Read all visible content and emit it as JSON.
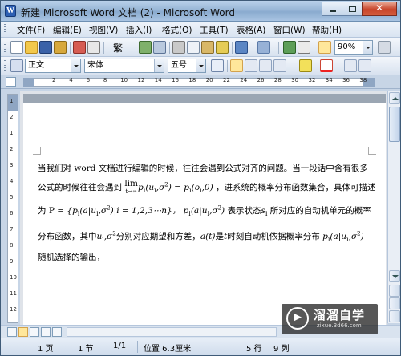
{
  "window": {
    "title": "新建 Microsoft Word 文档 (2) - Microsoft Word",
    "icon_name": "word-app-icon",
    "minimize_icon": "minimize-icon",
    "maximize_icon": "maximize-icon",
    "close_icon": "close-icon",
    "close_glyph": "✕"
  },
  "menubar": {
    "items": [
      "文件(F)",
      "编辑(E)",
      "视图(V)",
      "插入(I)",
      "格式(O)",
      "工具(T)",
      "表格(A)",
      "窗口(W)",
      "帮助(H)"
    ]
  },
  "standard_toolbar": {
    "traditional_label": "繁",
    "zoom": "90%",
    "icons": [
      "new-icon",
      "open-icon",
      "save-icon",
      "permission-icon",
      "email-icon",
      "print-icon",
      "print-preview-icon",
      "simplified-traditional-icon",
      "spelling-icon",
      "research-icon",
      "cut-icon",
      "copy-icon",
      "paste-icon",
      "format-painter-icon",
      "undo-icon",
      "redo-icon",
      "hyperlink-icon",
      "tables-borders-icon",
      "insert-table-icon",
      "drawing-icon",
      "show-hide-icon",
      "zoom-icon"
    ]
  },
  "formatting_toolbar": {
    "style": "正文",
    "font": "宋体",
    "size": "五号",
    "icons": [
      "styles-icon",
      "equation-icon",
      "align-left-icon",
      "align-center-icon",
      "align-right-icon",
      "justify-icon",
      "numbering-icon",
      "bullets-icon",
      "highlight-icon",
      "font-color-icon",
      "grow-font-icon",
      "shrink-font-icon"
    ]
  },
  "ruler": {
    "numbers": [
      "2",
      "4",
      "6",
      "8",
      "10",
      "12",
      "14",
      "16",
      "18",
      "20",
      "22",
      "24",
      "26",
      "28",
      "30",
      "32",
      "34",
      "36",
      "38"
    ],
    "vertical_numbers": [
      "1",
      "2",
      "1",
      "2",
      "3",
      "4",
      "5",
      "6",
      "7",
      "8",
      "9",
      "10",
      "11",
      "12"
    ]
  },
  "document": {
    "line1": "当我们对 word 文档进行编辑的时候，往往会遇到公式对齐的问题。当一段话中含有很多",
    "line2_a": "公式的时候往往会遇到",
    "line2_math_lim": "lim",
    "line2_math_sub": "t→∞",
    "line2_math_b": "p",
    "line2_math_c": "(u",
    "line2_math_d": "i",
    "line2_math_e": ",σ",
    "line2_math_f": "2",
    "line2_math_g": ") = p",
    "line2_math_h": "i",
    "line2_math_i": "(o",
    "line2_math_j": "i",
    "line2_math_k": ",0)",
    "line2_b": "，进系统的概率分布函数集合，具体可描述",
    "line3_a": "为 P =",
    "line3_math": "{p",
    "line3_math2": "i",
    "line3_math3": "(a|u",
    "line3_math4": "i",
    "line3_math5": ",σ",
    "line3_math6": "2",
    "line3_math7": ")|i = 1,2,3⋯n}",
    "line3_b": "， p",
    "line3_b_sub": "i",
    "line3_b2": "(a|u",
    "line3_b3": "i",
    "line3_b4": ",σ",
    "line3_b5": "2",
    "line3_b6": ")",
    "line3_c": "表示状态",
    "line3_s": "s",
    "line3_s_sub": "i",
    "line3_d": "所对应的自动机单元的概率",
    "line4_a": "分布函数，其中",
    "line4_u": "u",
    "line4_u_sub": "i",
    "line4_sig": ",σ",
    "line4_sig_sup": "2",
    "line4_b": "分别对应期望和方差，",
    "line4_at": "a(t)",
    "line4_c": "是",
    "line4_t": "t",
    "line4_d": "时刻自动机依据概率分布",
    "line4_p": "p",
    "line4_p_sub": "i",
    "line4_p2": "(a|u",
    "line4_p3": "i",
    "line4_p4": ",σ",
    "line4_p5": "2",
    "line4_p6": ")",
    "line5": "随机选择的输出，"
  },
  "statusbar": {
    "page": "1 页",
    "section": "1 节",
    "page_of": "1/1",
    "position": "位置 6.3厘米",
    "line": "5 行",
    "col": "9 列"
  },
  "watermark": {
    "title": "溜溜自学",
    "subtitle": "zixue.3d66.com"
  }
}
